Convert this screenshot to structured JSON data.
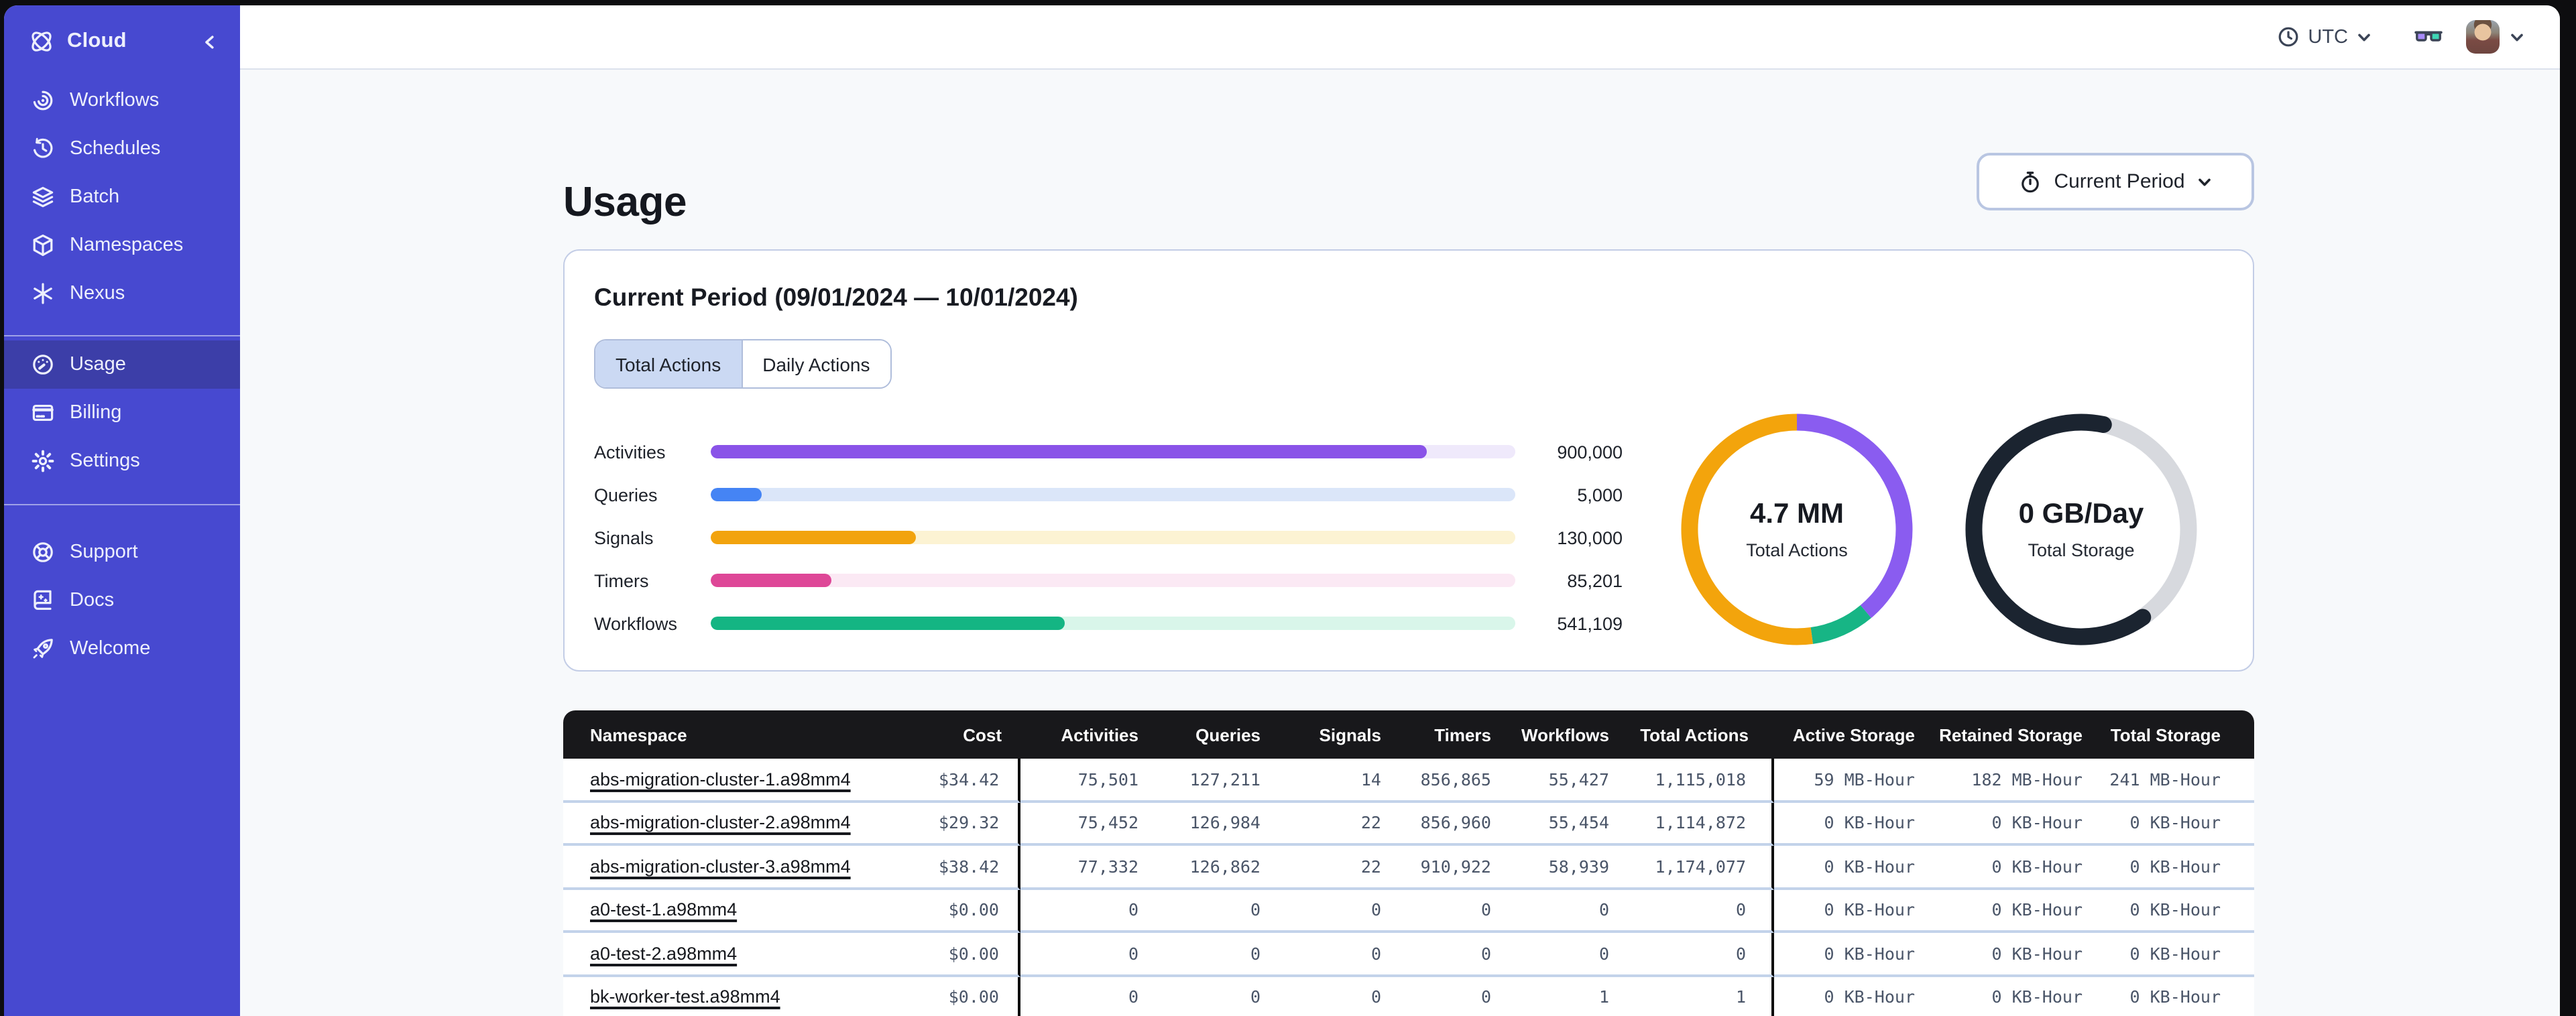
{
  "sidebar": {
    "brand": {
      "label": "Cloud"
    },
    "nav_main": [
      {
        "icon": "workflows",
        "label": "Workflows"
      },
      {
        "icon": "schedules",
        "label": "Schedules"
      },
      {
        "icon": "batch",
        "label": "Batch"
      },
      {
        "icon": "namespaces",
        "label": "Namespaces"
      },
      {
        "icon": "nexus",
        "label": "Nexus"
      }
    ],
    "nav_account": [
      {
        "icon": "usage",
        "label": "Usage",
        "selected": true
      },
      {
        "icon": "billing",
        "label": "Billing"
      },
      {
        "icon": "settings",
        "label": "Settings"
      }
    ],
    "nav_help": [
      {
        "icon": "support",
        "label": "Support"
      },
      {
        "icon": "docs",
        "label": "Docs"
      },
      {
        "icon": "welcome",
        "label": "Welcome"
      }
    ],
    "colors": {
      "background": "#4749D0",
      "selected": "#3C3EA8"
    }
  },
  "topbar": {
    "timezone": "UTC"
  },
  "page": {
    "title": "Usage",
    "period_button_label": "Current Period"
  },
  "usage_card": {
    "title": "Current Period (09/01/2024 — 10/01/2024)",
    "tabs": [
      {
        "label": "Total Actions",
        "selected": true
      },
      {
        "label": "Daily Actions",
        "selected": false
      }
    ]
  },
  "chart_data": [
    {
      "type": "bar",
      "orientation": "horizontal",
      "categories": [
        "Activities",
        "Queries",
        "Signals",
        "Timers",
        "Workflows"
      ],
      "values": [
        900000,
        5000,
        130000,
        85201,
        541109
      ],
      "display_values": [
        "900,000",
        "5,000",
        "130,000",
        "85,201",
        "541,109"
      ],
      "fill_percent": [
        89,
        6.3,
        25.5,
        15,
        44
      ],
      "colors": [
        "#8A53E8",
        "#4584F4",
        "#F2A30D",
        "#DE4797",
        "#14B583"
      ],
      "track_colors": [
        "#EFE9FB",
        "#DBE6F9",
        "#FCF3D3",
        "#FBE9F4",
        "#D9F6EA"
      ]
    },
    {
      "type": "donut",
      "center_value": "4.7 MM",
      "center_label": "Total Actions",
      "segments": [
        {
          "name": "segment-purple",
          "color": "#8A5CF0",
          "start_deg": 0,
          "end_deg": 140
        },
        {
          "name": "segment-green",
          "color": "#17B585",
          "start_deg": 140,
          "end_deg": 172
        },
        {
          "name": "segment-orange",
          "color": "#F3A40C",
          "start_deg": 172,
          "end_deg": 360
        }
      ]
    },
    {
      "type": "donut",
      "center_value": "0 GB/Day",
      "center_label": "Total Storage",
      "track_color": "#D7D9DE",
      "segments": [
        {
          "name": "segment-dark",
          "color": "#1B2430",
          "start_deg": 145,
          "end_deg": 372,
          "cap": "round"
        }
      ]
    }
  ],
  "table": {
    "columns": [
      {
        "key": "namespace",
        "label": "Namespace"
      },
      {
        "key": "cost",
        "label": "Cost"
      },
      {
        "key": "activities",
        "label": "Activities"
      },
      {
        "key": "queries",
        "label": "Queries"
      },
      {
        "key": "signals",
        "label": "Signals"
      },
      {
        "key": "timers",
        "label": "Timers"
      },
      {
        "key": "workflows",
        "label": "Workflows"
      },
      {
        "key": "total_actions",
        "label": "Total Actions"
      },
      {
        "key": "active_storage",
        "label": "Active Storage"
      },
      {
        "key": "retained_storage",
        "label": "Retained Storage"
      },
      {
        "key": "total_storage",
        "label": "Total Storage"
      }
    ],
    "rows": [
      {
        "namespace": "abs-migration-cluster-1.a98mm4",
        "cost": "$34.42",
        "activities": "75,501",
        "queries": "127,211",
        "signals": "14",
        "timers": "856,865",
        "workflows": "55,427",
        "total_actions": "1,115,018",
        "active_storage": "59 MB-Hour",
        "retained_storage": "182 MB-Hour",
        "total_storage": "241 MB-Hour"
      },
      {
        "namespace": "abs-migration-cluster-2.a98mm4",
        "cost": "$29.32",
        "activities": "75,452",
        "queries": "126,984",
        "signals": "22",
        "timers": "856,960",
        "workflows": "55,454",
        "total_actions": "1,114,872",
        "active_storage": "0 KB-Hour",
        "retained_storage": "0 KB-Hour",
        "total_storage": "0 KB-Hour"
      },
      {
        "namespace": "abs-migration-cluster-3.a98mm4",
        "cost": "$38.42",
        "activities": "77,332",
        "queries": "126,862",
        "signals": "22",
        "timers": "910,922",
        "workflows": "58,939",
        "total_actions": "1,174,077",
        "active_storage": "0 KB-Hour",
        "retained_storage": "0 KB-Hour",
        "total_storage": "0 KB-Hour"
      },
      {
        "namespace": "a0-test-1.a98mm4",
        "cost": "$0.00",
        "activities": "0",
        "queries": "0",
        "signals": "0",
        "timers": "0",
        "workflows": "0",
        "total_actions": "0",
        "active_storage": "0 KB-Hour",
        "retained_storage": "0 KB-Hour",
        "total_storage": "0 KB-Hour"
      },
      {
        "namespace": "a0-test-2.a98mm4",
        "cost": "$0.00",
        "activities": "0",
        "queries": "0",
        "signals": "0",
        "timers": "0",
        "workflows": "0",
        "total_actions": "0",
        "active_storage": "0 KB-Hour",
        "retained_storage": "0 KB-Hour",
        "total_storage": "0 KB-Hour"
      },
      {
        "namespace": "bk-worker-test.a98mm4",
        "cost": "$0.00",
        "activities": "0",
        "queries": "0",
        "signals": "0",
        "timers": "0",
        "workflows": "1",
        "total_actions": "1",
        "active_storage": "0 KB-Hour",
        "retained_storage": "0 KB-Hour",
        "total_storage": "0 KB-Hour"
      }
    ]
  }
}
